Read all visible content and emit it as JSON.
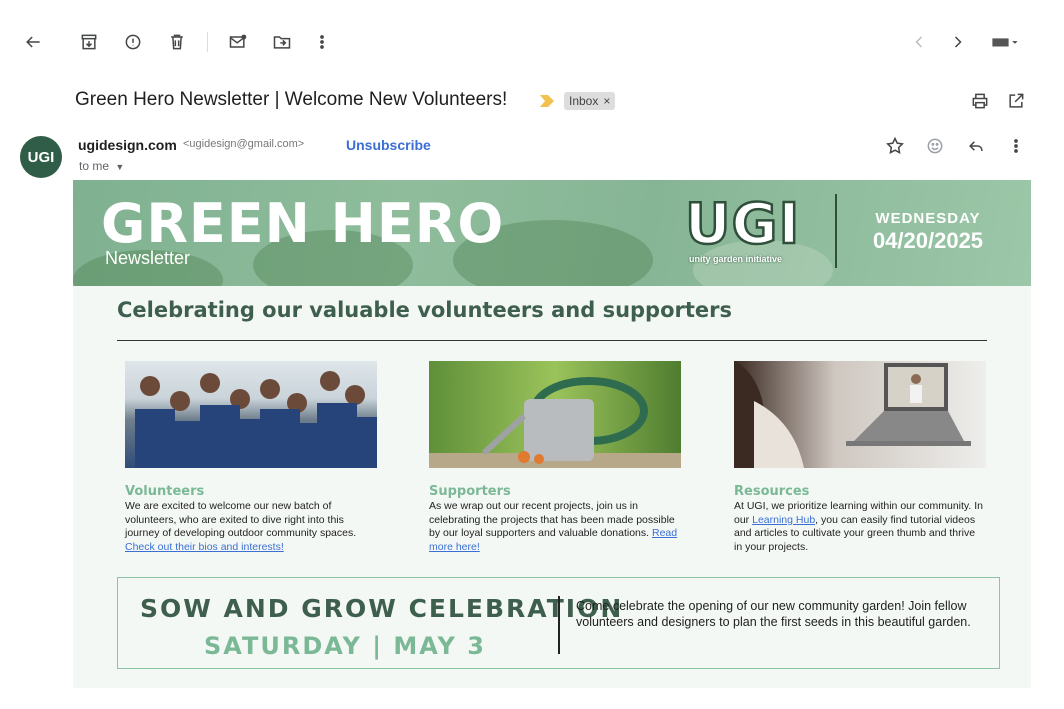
{
  "toolbar": {
    "back": "arrow-left-icon",
    "archive": "archive-icon",
    "spam": "report-spam-icon",
    "delete": "trash-icon",
    "mark_unread": "mark-unread-icon",
    "move": "move-to-folder-icon",
    "more": "more-vertical-icon",
    "prev": "chevron-left-icon",
    "next": "chevron-right-icon",
    "input_tools": "keyboard-icon"
  },
  "email": {
    "subject": "Green Hero Newsletter | Welcome New Volunteers!",
    "label": "Inbox",
    "label_close": "×",
    "sender": {
      "avatar_text": "UGI",
      "name": "ugidesign.com",
      "email": "<ugidesign@gmail.com>",
      "unsubscribe": "Unsubscribe",
      "to": "to me"
    }
  },
  "newsletter": {
    "banner": {
      "title": "GREEN HERO",
      "subtitle": "Newsletter",
      "logo": "UGI",
      "logo_tagline": "unity garden initiative",
      "day": "WEDNESDAY",
      "date": "04/20/2025"
    },
    "headline": "Celebrating our valuable volunteers and supporters",
    "columns": [
      {
        "title": "Volunteers",
        "text": "We are excited to welcome our new batch of volunteers, who are exited to dive right into this journey of developing outdoor community spaces.",
        "link": "Check out their bios and interests!"
      },
      {
        "title": "Supporters",
        "text": "As we wrap out our recent projects, join us in celebrating the projects that has been made possible by our loyal supporters and valuable donations.",
        "link": "Read more here!"
      },
      {
        "title": "Resources",
        "text_before": "At UGI, we prioritize learning within our community. In our",
        "link": "Learning Hub",
        "text_after": ", you can easily find tutorial videos and articles to cultivate your green thumb and thrive in your projects."
      }
    ],
    "event": {
      "title": "SOW AND GROW CELEBRATION",
      "date": "SATURDAY | MAY 3",
      "description": "Come celebrate the opening of our new community garden! Join fellow volunteers and designers to plan the first seeds in this beautiful garden."
    }
  },
  "colors": {
    "brand_dark": "#3f5f4e",
    "brand_light": "#7bb896",
    "avatar": "#2f5d48",
    "link": "#3b6fd4"
  }
}
